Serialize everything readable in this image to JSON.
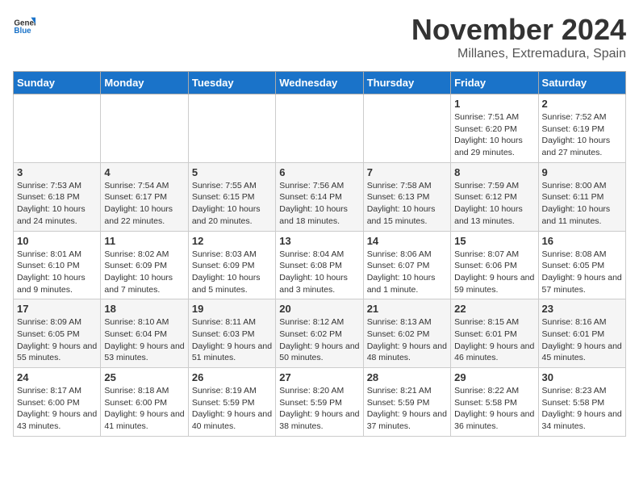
{
  "header": {
    "logo_general": "General",
    "logo_blue": "Blue",
    "title": "November 2024",
    "location": "Millanes, Extremadura, Spain"
  },
  "days_of_week": [
    "Sunday",
    "Monday",
    "Tuesday",
    "Wednesday",
    "Thursday",
    "Friday",
    "Saturday"
  ],
  "weeks": [
    [
      {
        "day": "",
        "info": ""
      },
      {
        "day": "",
        "info": ""
      },
      {
        "day": "",
        "info": ""
      },
      {
        "day": "",
        "info": ""
      },
      {
        "day": "",
        "info": ""
      },
      {
        "day": "1",
        "info": "Sunrise: 7:51 AM\nSunset: 6:20 PM\nDaylight: 10 hours and 29 minutes."
      },
      {
        "day": "2",
        "info": "Sunrise: 7:52 AM\nSunset: 6:19 PM\nDaylight: 10 hours and 27 minutes."
      }
    ],
    [
      {
        "day": "3",
        "info": "Sunrise: 7:53 AM\nSunset: 6:18 PM\nDaylight: 10 hours and 24 minutes."
      },
      {
        "day": "4",
        "info": "Sunrise: 7:54 AM\nSunset: 6:17 PM\nDaylight: 10 hours and 22 minutes."
      },
      {
        "day": "5",
        "info": "Sunrise: 7:55 AM\nSunset: 6:15 PM\nDaylight: 10 hours and 20 minutes."
      },
      {
        "day": "6",
        "info": "Sunrise: 7:56 AM\nSunset: 6:14 PM\nDaylight: 10 hours and 18 minutes."
      },
      {
        "day": "7",
        "info": "Sunrise: 7:58 AM\nSunset: 6:13 PM\nDaylight: 10 hours and 15 minutes."
      },
      {
        "day": "8",
        "info": "Sunrise: 7:59 AM\nSunset: 6:12 PM\nDaylight: 10 hours and 13 minutes."
      },
      {
        "day": "9",
        "info": "Sunrise: 8:00 AM\nSunset: 6:11 PM\nDaylight: 10 hours and 11 minutes."
      }
    ],
    [
      {
        "day": "10",
        "info": "Sunrise: 8:01 AM\nSunset: 6:10 PM\nDaylight: 10 hours and 9 minutes."
      },
      {
        "day": "11",
        "info": "Sunrise: 8:02 AM\nSunset: 6:09 PM\nDaylight: 10 hours and 7 minutes."
      },
      {
        "day": "12",
        "info": "Sunrise: 8:03 AM\nSunset: 6:09 PM\nDaylight: 10 hours and 5 minutes."
      },
      {
        "day": "13",
        "info": "Sunrise: 8:04 AM\nSunset: 6:08 PM\nDaylight: 10 hours and 3 minutes."
      },
      {
        "day": "14",
        "info": "Sunrise: 8:06 AM\nSunset: 6:07 PM\nDaylight: 10 hours and 1 minute."
      },
      {
        "day": "15",
        "info": "Sunrise: 8:07 AM\nSunset: 6:06 PM\nDaylight: 9 hours and 59 minutes."
      },
      {
        "day": "16",
        "info": "Sunrise: 8:08 AM\nSunset: 6:05 PM\nDaylight: 9 hours and 57 minutes."
      }
    ],
    [
      {
        "day": "17",
        "info": "Sunrise: 8:09 AM\nSunset: 6:05 PM\nDaylight: 9 hours and 55 minutes."
      },
      {
        "day": "18",
        "info": "Sunrise: 8:10 AM\nSunset: 6:04 PM\nDaylight: 9 hours and 53 minutes."
      },
      {
        "day": "19",
        "info": "Sunrise: 8:11 AM\nSunset: 6:03 PM\nDaylight: 9 hours and 51 minutes."
      },
      {
        "day": "20",
        "info": "Sunrise: 8:12 AM\nSunset: 6:02 PM\nDaylight: 9 hours and 50 minutes."
      },
      {
        "day": "21",
        "info": "Sunrise: 8:13 AM\nSunset: 6:02 PM\nDaylight: 9 hours and 48 minutes."
      },
      {
        "day": "22",
        "info": "Sunrise: 8:15 AM\nSunset: 6:01 PM\nDaylight: 9 hours and 46 minutes."
      },
      {
        "day": "23",
        "info": "Sunrise: 8:16 AM\nSunset: 6:01 PM\nDaylight: 9 hours and 45 minutes."
      }
    ],
    [
      {
        "day": "24",
        "info": "Sunrise: 8:17 AM\nSunset: 6:00 PM\nDaylight: 9 hours and 43 minutes."
      },
      {
        "day": "25",
        "info": "Sunrise: 8:18 AM\nSunset: 6:00 PM\nDaylight: 9 hours and 41 minutes."
      },
      {
        "day": "26",
        "info": "Sunrise: 8:19 AM\nSunset: 5:59 PM\nDaylight: 9 hours and 40 minutes."
      },
      {
        "day": "27",
        "info": "Sunrise: 8:20 AM\nSunset: 5:59 PM\nDaylight: 9 hours and 38 minutes."
      },
      {
        "day": "28",
        "info": "Sunrise: 8:21 AM\nSunset: 5:59 PM\nDaylight: 9 hours and 37 minutes."
      },
      {
        "day": "29",
        "info": "Sunrise: 8:22 AM\nSunset: 5:58 PM\nDaylight: 9 hours and 36 minutes."
      },
      {
        "day": "30",
        "info": "Sunrise: 8:23 AM\nSunset: 5:58 PM\nDaylight: 9 hours and 34 minutes."
      }
    ]
  ]
}
